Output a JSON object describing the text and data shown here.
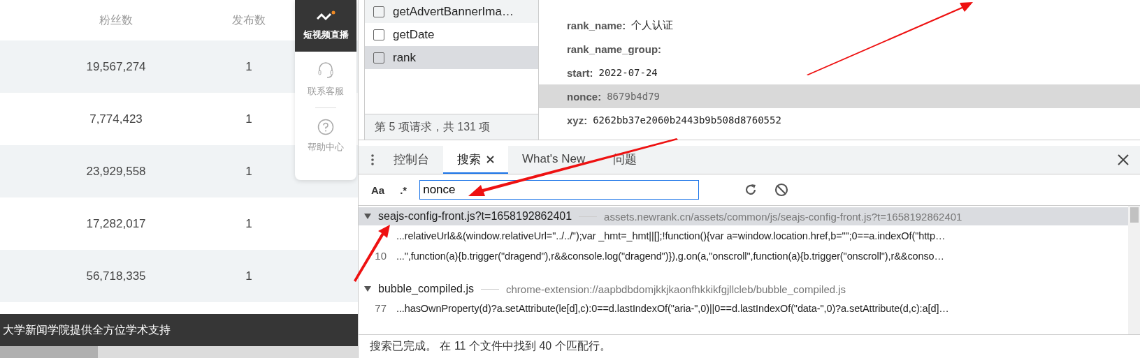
{
  "page": {
    "columns": [
      "粉丝数",
      "发布数"
    ],
    "rows": [
      {
        "fans": "19,567,274",
        "posts": "1"
      },
      {
        "fans": "7,774,423",
        "posts": "1"
      },
      {
        "fans": "23,929,558",
        "posts": "1"
      },
      {
        "fans": "17,282,017",
        "posts": "1"
      },
      {
        "fans": "56,718,335",
        "posts": "1"
      }
    ],
    "footer": "大学新闻学院提供全方位学术支持",
    "sidebar": [
      {
        "kind": "live",
        "label": "短视频直播",
        "selected": true
      },
      {
        "kind": "support",
        "label": "联系客服",
        "selected": false
      },
      {
        "kind": "help",
        "label": "帮助中心",
        "selected": false
      }
    ]
  },
  "network": {
    "requests": [
      {
        "name": "getAdvertBannerIma…",
        "selected": false,
        "hovered": true
      },
      {
        "name": "getDate",
        "selected": false,
        "hovered": false
      },
      {
        "name": "rank",
        "selected": true,
        "hovered": false
      }
    ],
    "status": "第 5 项请求，共 131 项"
  },
  "payload": [
    {
      "key": "rank_name:",
      "value": "个人认证",
      "kind": "text",
      "selected": false
    },
    {
      "key": "rank_name_group:",
      "selected": false
    },
    {
      "key": "start:",
      "value": "2022-07-24",
      "kind": "mono",
      "selected": false
    },
    {
      "key": "nonce:",
      "value": "8679b4d79",
      "kind": "mono",
      "selected": true
    },
    {
      "key": "xyz:",
      "value": "6262bb37e2060b2443b9b508d8760552",
      "kind": "mono",
      "selected": false
    }
  ],
  "drawer": {
    "tabs": [
      {
        "label": "控制台",
        "selected": false,
        "closable": false
      },
      {
        "label": "搜索",
        "selected": true,
        "closable": true
      },
      {
        "label": "What's New",
        "selected": false,
        "closable": false
      },
      {
        "label": "问题",
        "selected": false,
        "closable": false
      }
    ]
  },
  "search": {
    "case_label": "Aa",
    "regex_label": ".*",
    "value": "nonce"
  },
  "results": [
    {
      "file": "seajs-config-front.js?t=1658192862401",
      "path": "assets.newrank.cn/assets/common/js/seajs-config-front.js?t=1658192862401",
      "selected": true,
      "matches": [
        {
          "text": "...relativeUrl&&(window.relativeUrl=\"../../\");var _hmt=_hmt||[];!function(){var a=window.location.href,b=\"\";0==a.indexOf(\"http…"
        },
        {
          "line": "10",
          "text": "...\",function(a){b.trigger(\"dragend\"),r&&console.log(\"dragend\")}),g.on(a,\"onscroll\",function(a){b.trigger(\"onscroll\"),r&&conso…"
        }
      ]
    },
    {
      "file": "bubble_compiled.js",
      "path": "chrome-extension://aapbdbdomjkkjkaonfhkkikfgjllcleb/bubble_compiled.js",
      "selected": false,
      "matches": [
        {
          "line": "77",
          "text": "...hasOwnProperty(d)?a.setAttribute(le[d],c):0==d.lastIndexOf(\"aria-\",0)||0==d.lastIndexOf(\"data-\",0)?a.setAttribute(d,c):a[d]…"
        }
      ]
    }
  ],
  "status": "搜索已完成。 在 11 个文件中找到 40 个匹配行。"
}
